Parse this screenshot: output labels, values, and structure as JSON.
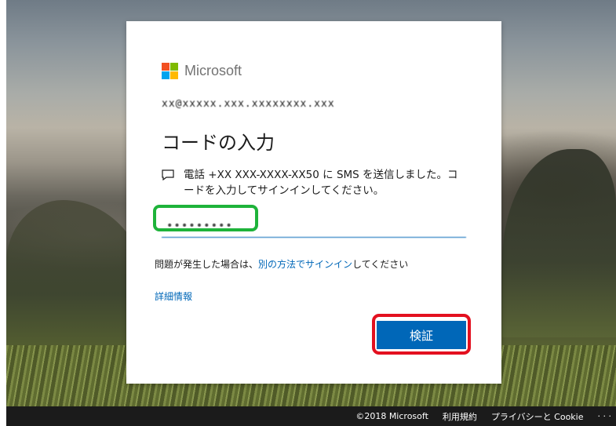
{
  "brand": {
    "name": "Microsoft",
    "colors": {
      "red": "#f25022",
      "green": "#7fba00",
      "blue": "#00a4ef",
      "yellow": "#ffb900"
    }
  },
  "account": {
    "identity": "xx@xxxxx.xxx.xxxxxxxx.xxx"
  },
  "page": {
    "title": "コードの入力"
  },
  "sms": {
    "icon": "chat-icon",
    "message": "電話 +XX XXX-XXXX-XX50 に SMS を送信しました。コードを入力してサインインしてください。"
  },
  "code_input": {
    "value": "•••••••••",
    "placeholder": ""
  },
  "help": {
    "prefix": "問題が発生した場合は、",
    "link": "別の方法でサインイン",
    "suffix": "してください"
  },
  "more_info": "詳細情報",
  "verify_button": "検証",
  "annotations": {
    "input_highlight_color": "#1eb33a",
    "button_highlight_color": "#e3101f"
  },
  "footer": {
    "copyright": "©2018 Microsoft",
    "terms": "利用規約",
    "privacy": "プライバシーと Cookie",
    "more": "· · ·"
  }
}
